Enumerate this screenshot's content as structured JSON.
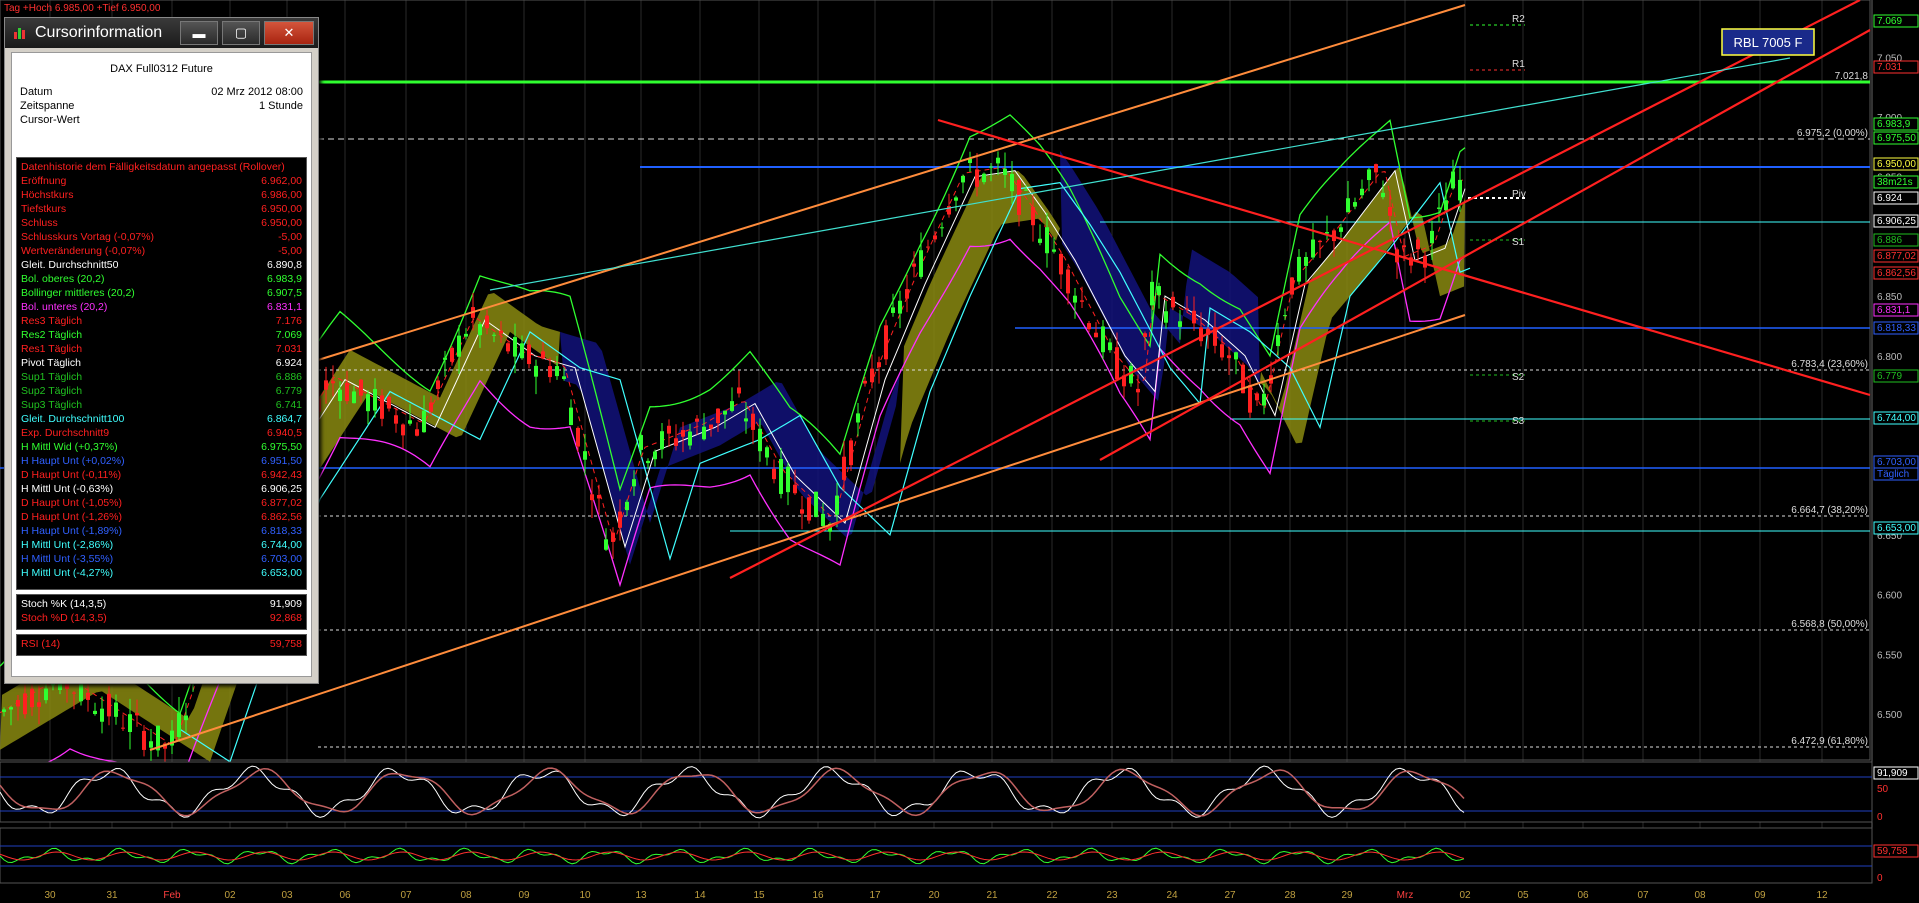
{
  "top_status": "Tag +Hoch 6.985,00 +Tief 6.950,00",
  "badge_rbl": "RBL 7005 F",
  "cursor_window": {
    "title": "Cursorinformation",
    "btn_min": "▬",
    "btn_max": "▢",
    "btn_close": "✕",
    "instrument": "DAX Full0312 Future",
    "fields": [
      {
        "label": "Datum",
        "value": "02 Mrz 2012 08:00"
      },
      {
        "label": "Zeitspanne",
        "value": "1 Stunde"
      },
      {
        "label": "Cursor-Wert",
        "value": ""
      }
    ],
    "rows": [
      {
        "label": "Datenhistorie dem Fälligkeitsdatum angepasst (Rollover)",
        "value": "",
        "color": "#ff2020"
      },
      {
        "label": "Eröffnung",
        "value": "6.962,00",
        "color": "#ff2020"
      },
      {
        "label": "Höchstkurs",
        "value": "6.986,00",
        "color": "#ff2020"
      },
      {
        "label": "Tiefstkurs",
        "value": "6.950,00",
        "color": "#ff2020"
      },
      {
        "label": "Schluss",
        "value": "6.950,00",
        "color": "#ff2020"
      },
      {
        "label": "Schlusskurs Vortag (-0,07%)",
        "value": "-5,00",
        "color": "#ff2020"
      },
      {
        "label": "Wertveränderung (-0,07%)",
        "value": "-5,00",
        "color": "#ff2020"
      },
      {
        "label": "Gleit. Durchschnitt50",
        "value": "6.890,8",
        "color": "#ffffff"
      },
      {
        "label": "Bol. oberes (20,2)",
        "value": "6.983,9",
        "color": "#30ff30"
      },
      {
        "label": "Bollinger mittleres (20,2)",
        "value": "6.907,5",
        "color": "#30ff30"
      },
      {
        "label": "Bol. unteres (20,2)",
        "value": "6.831,1",
        "color": "#ff30ff"
      },
      {
        "label": "Res3 Täglich",
        "value": "7.176",
        "color": "#ff2020"
      },
      {
        "label": "Res2 Täglich",
        "value": "7.069",
        "color": "#30ff30"
      },
      {
        "label": "Res1 Täglich",
        "value": "7.031",
        "color": "#ff2020"
      },
      {
        "label": "Pivot Täglich",
        "value": "6.924",
        "color": "#ffffff"
      },
      {
        "label": "Sup1 Täglich",
        "value": "6.886",
        "color": "#20c020"
      },
      {
        "label": "Sup2 Täglich",
        "value": "6.779",
        "color": "#20c020"
      },
      {
        "label": "Sup3 Täglich",
        "value": "6.741",
        "color": "#20c020"
      },
      {
        "label": "Gleit. Durchschnitt100",
        "value": "6.864,7",
        "color": "#40ffff"
      },
      {
        "label": "Exp. Durchschnitt9",
        "value": "6.940,5",
        "color": "#ff2020"
      },
      {
        "label": "H Mittl Wid (+0,37%)",
        "value": "6.975,50",
        "color": "#30ff30"
      },
      {
        "label": "H Haupt Unt (+0,02%)",
        "value": "6.951,50",
        "color": "#3060ff"
      },
      {
        "label": "D Haupt Unt (-0,11%)",
        "value": "6.942,43",
        "color": "#ff2020"
      },
      {
        "label": "H Mittl Unt (-0,63%)",
        "value": "6.906,25",
        "color": "#ffffff"
      },
      {
        "label": "D Haupt Unt (-1,05%)",
        "value": "6.877,02",
        "color": "#ff2020"
      },
      {
        "label": "D Haupt Unt (-1,26%)",
        "value": "6.862,56",
        "color": "#ff2020"
      },
      {
        "label": "H Haupt Unt (-1,89%)",
        "value": "6.818,33",
        "color": "#3060ff"
      },
      {
        "label": "H Mittl Unt (-2,86%)",
        "value": "6.744,00",
        "color": "#40ffff"
      },
      {
        "label": "H Mittl Unt (-3,55%)",
        "value": "6.703,00",
        "color": "#3060ff"
      },
      {
        "label": "H Mittl Unt (-4,27%)",
        "value": "6.653,00",
        "color": "#40ffff"
      }
    ],
    "stoch_rows": [
      {
        "label": "Stoch %K (14,3,5)",
        "value": "91,909",
        "color": "#ffffff"
      },
      {
        "label": "Stoch %D (14,3,5)",
        "value": "92,868",
        "color": "#ff2020"
      }
    ],
    "rsi_row": {
      "label": "RSI (14)",
      "value": "59,758",
      "color": "#ff2020"
    }
  },
  "price_axis": {
    "ticks": [
      "7.050",
      "7.000",
      "6.950",
      "6.900",
      "6.850",
      "6.800",
      "6.750",
      "6.700",
      "6.650",
      "6.600",
      "6.550",
      "6.500"
    ],
    "labels": [
      {
        "text": "7.069",
        "color": "#30ff30"
      },
      {
        "text": "7.031",
        "color": "#ff3030"
      },
      {
        "text": "6.983,9",
        "color": "#30ff30"
      },
      {
        "text": "6.975,50",
        "color": "#30ff30"
      },
      {
        "text": "6.950,00",
        "color": "#ffff40"
      },
      {
        "text": "38m21s",
        "color": "#30ff30"
      },
      {
        "text": "6.924",
        "color": "#ffffff"
      },
      {
        "text": "6.906,25",
        "color": "#ffffff"
      },
      {
        "text": "6.886",
        "color": "#20c020"
      },
      {
        "text": "6.877,02",
        "color": "#ff3030"
      },
      {
        "text": "6.862,56",
        "color": "#ff3030"
      },
      {
        "text": "6.831,1",
        "color": "#ff30ff"
      },
      {
        "text": "6.818,33",
        "color": "#3060ff"
      },
      {
        "text": "6.779",
        "color": "#20c020"
      },
      {
        "text": "6.744,00",
        "color": "#40ffff"
      },
      {
        "text": "6.703,00",
        "color": "#3060ff"
      },
      {
        "text": "Täglich",
        "color": "#3060ff"
      },
      {
        "text": "6.653,00",
        "color": "#40ffff"
      }
    ]
  },
  "fib_labels": [
    "6.975,2 (0,00%)",
    "6.783,4 (23,60%)",
    "6.664,7 (38,20%)",
    "6.568,8 (50,00%)",
    "6.472,9 (61,80%)",
    "7.021,8"
  ],
  "pivot_labels": [
    "R2",
    "R1",
    "Piv",
    "S1",
    "S2",
    "S3"
  ],
  "stoch_axis": [
    "91,909",
    "50",
    "0"
  ],
  "rsi_axis": [
    "59,758",
    "0"
  ],
  "date_labels": [
    "30",
    "31",
    "Feb",
    "02",
    "03",
    "06",
    "07",
    "08",
    "09",
    "10",
    "13",
    "14",
    "15",
    "16",
    "17",
    "20",
    "21",
    "22",
    "23",
    "24",
    "27",
    "28",
    "29",
    "Mrz",
    "02",
    "05",
    "06",
    "07",
    "08",
    "09",
    "12"
  ],
  "colors": {
    "bull": "#30ff30",
    "bear": "#ff2020",
    "boll_upper": "#30ff30",
    "boll_lower": "#ff30ff",
    "ma100": "#40ffff",
    "channel": "#ff8c3c",
    "trend_red": "#ff2020",
    "h_blue": "#2060ff"
  }
}
